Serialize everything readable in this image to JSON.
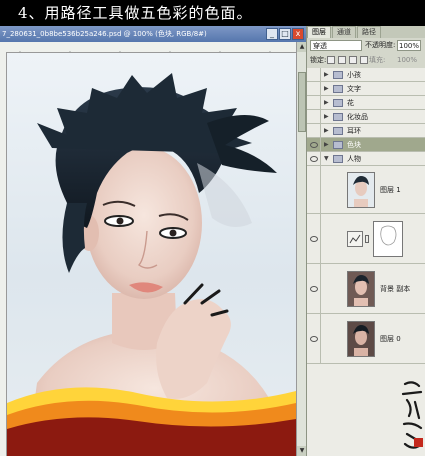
{
  "caption": "4、用路径工具做五色彩的色面。",
  "document": {
    "title": "7_280631_0b8be536b25a246.psd @ 100% (色块, RGB/8#)",
    "minimize_glyph": "_",
    "restore_glyph": "□",
    "close_glyph": "x"
  },
  "panel": {
    "tabs": [
      "图层",
      "通道",
      "路径"
    ],
    "active_tab": "图层",
    "blend_mode": "穿透",
    "opacity_label": "不透明度:",
    "opacity_value": "100%",
    "lock_label": "锁定:",
    "fill_label": "填充:",
    "fill_value": "100%",
    "layers": [
      {
        "name": "小孩",
        "type": "group",
        "visible": false
      },
      {
        "name": "文字",
        "type": "group",
        "visible": false
      },
      {
        "name": "花",
        "type": "group",
        "visible": false
      },
      {
        "name": "化妆品",
        "type": "group",
        "visible": false
      },
      {
        "name": "耳环",
        "type": "group",
        "visible": false
      },
      {
        "name": "色块",
        "type": "group",
        "visible": true,
        "selected": true
      },
      {
        "name": "人物",
        "type": "group-open",
        "visible": true
      },
      {
        "name": "图层 1",
        "type": "layer",
        "visible": false
      },
      {
        "name": "",
        "type": "adjustment",
        "visible": true
      },
      {
        "name": "背景 副本",
        "type": "layer",
        "visible": true
      },
      {
        "name": "图层 0",
        "type": "layer",
        "visible": true
      }
    ]
  },
  "colors": {
    "banner_red": "#8c1a10",
    "banner_orange": "#f08a1c",
    "banner_yellow": "#ffd43a",
    "selected_row": "#a0a88d"
  }
}
